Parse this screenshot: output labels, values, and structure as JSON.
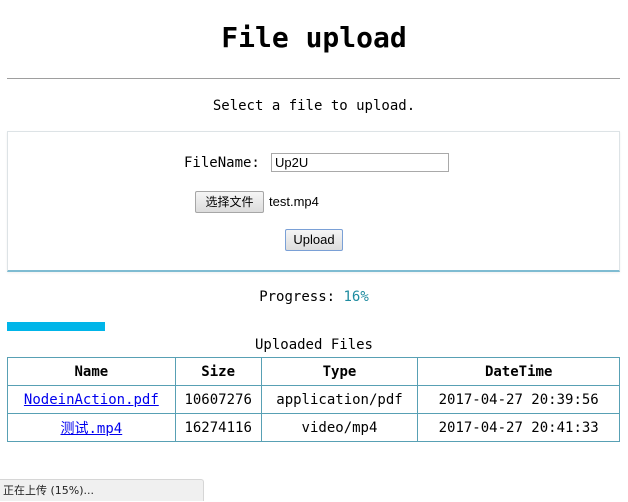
{
  "page": {
    "title": "File upload",
    "subtitle": "Select a file to upload."
  },
  "form": {
    "filename_label": "FileName:",
    "filename_value": "Up2U",
    "choose_button_label": "选择文件",
    "chosen_file": "test.mp4",
    "upload_button_label": "Upload"
  },
  "progress": {
    "label": "Progress: ",
    "value_text": "16%",
    "value_percent": 16
  },
  "uploads": {
    "caption": "Uploaded Files",
    "columns": [
      "Name",
      "Size",
      "Type",
      "DateTime"
    ],
    "rows": [
      [
        "NodeinAction.pdf",
        "10607276",
        "application/pdf",
        "2017-04-27 20:39:56"
      ],
      [
        "测试.mp4",
        "16274116",
        "video/mp4",
        "2017-04-27 20:41:33"
      ]
    ]
  },
  "status_bar": {
    "text": "正在上传 (15%)..."
  },
  "colors": {
    "progress_bar": "#00b5e9",
    "progress_value": "#1f8ca0",
    "table_border": "#58a0b4",
    "link": "#0000ee"
  }
}
